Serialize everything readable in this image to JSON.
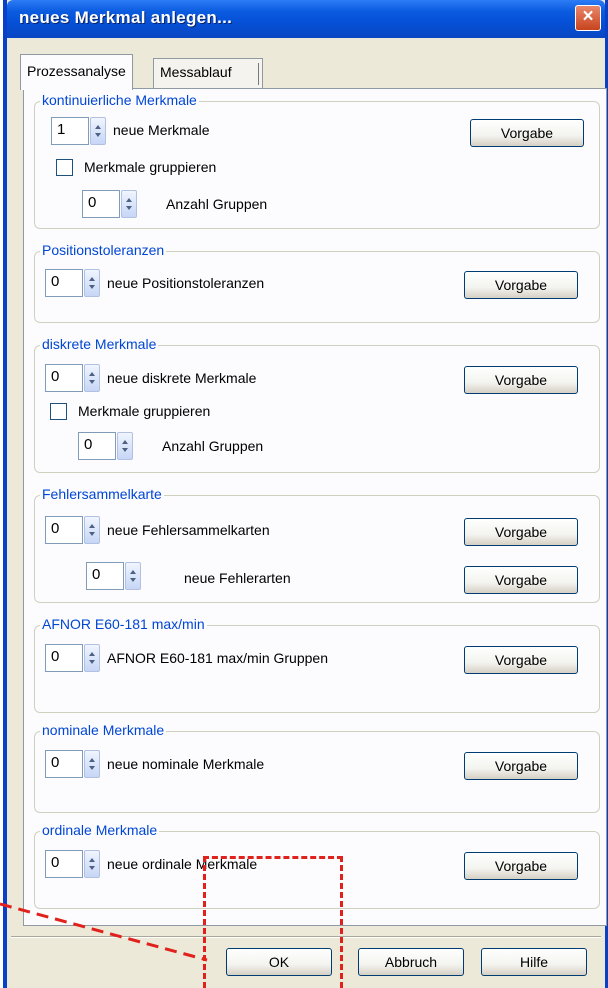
{
  "window": {
    "title": "neues Merkmal anlegen...",
    "close_glyph": "×"
  },
  "tabs": [
    {
      "label": "Prozessanalyse",
      "active": true
    },
    {
      "label": "Messablauf",
      "active": false
    }
  ],
  "groups": {
    "kontinuierlich": {
      "title": "kontinuierliche Merkmale",
      "count_value": "1",
      "count_label": "neue Merkmale",
      "group_checkbox_label": "Merkmale gruppieren",
      "group_checkbox_checked": false,
      "group_count_value": "0",
      "group_count_label": "Anzahl Gruppen",
      "default_button": "Vorgabe"
    },
    "position": {
      "title": "Positionstoleranzen",
      "count_value": "0",
      "count_label": "neue Positionstoleranzen",
      "default_button": "Vorgabe"
    },
    "diskret": {
      "title": "diskrete Merkmale",
      "count_value": "0",
      "count_label": "neue diskrete Merkmale",
      "group_checkbox_label": "Merkmale gruppieren",
      "group_checkbox_checked": false,
      "group_count_value": "0",
      "group_count_label": "Anzahl Gruppen",
      "default_button": "Vorgabe"
    },
    "fehlersammelkarte": {
      "title": "Fehlersammelkarte",
      "count_value": "0",
      "count_label": "neue Fehlersammelkarten",
      "default_button": "Vorgabe",
      "types_value": "0",
      "types_label": "neue Fehlerarten",
      "types_button": "Vorgabe"
    },
    "afnor": {
      "title": "AFNOR E60-181 max/min",
      "count_value": "0",
      "count_label": "AFNOR E60-181 max/min Gruppen",
      "default_button": "Vorgabe"
    },
    "nominal": {
      "title": "nominale Merkmale",
      "count_value": "0",
      "count_label": "neue nominale Merkmale",
      "default_button": "Vorgabe"
    },
    "ordinal": {
      "title": "ordinale Merkmale",
      "count_value": "0",
      "count_label": "neue ordinale Merkmale",
      "default_button": "Vorgabe"
    }
  },
  "footer": {
    "ok": "OK",
    "cancel": "Abbruch",
    "help": "Hilfe"
  },
  "colors": {
    "titlebar": "#0550d6",
    "group_title": "#0046d5",
    "annotation": "#e0211c",
    "dialog_bg": "#ece9d8"
  }
}
